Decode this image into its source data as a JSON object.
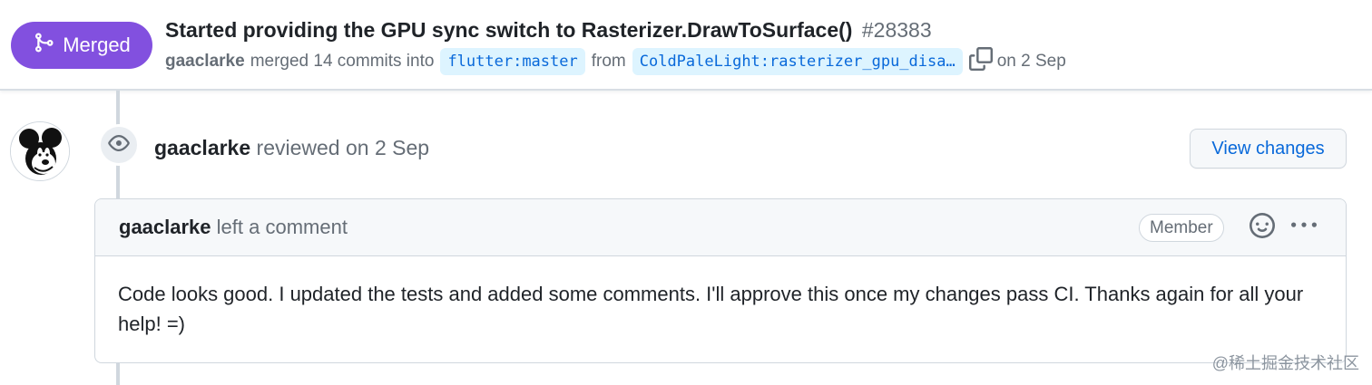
{
  "pr": {
    "state_label": "Merged",
    "state_color": "#8250df",
    "title": "Started providing the GPU sync switch to Rasterizer.DrawToSurface()",
    "number": "#28383",
    "author": "gaaclarke",
    "merged_text": "merged 14 commits into",
    "base_branch": "flutter:master",
    "from_text": "from",
    "head_branch": "ColdPaleLight:rasterizer_gpu_disable_sync_switch",
    "head_branch_display": "ColdPaleLight:rasterizer_gpu_disa…",
    "date_text": "on 2 Sep"
  },
  "review": {
    "author": "gaaclarke",
    "action_text": "reviewed on 2 Sep",
    "view_changes_label": "View changes"
  },
  "comment": {
    "author": "gaaclarke",
    "action_text": "left a comment",
    "role_label": "Member",
    "body": "Code looks good. I updated the tests and added some comments. I'll approve this once my changes pass CI. Thanks again for all your help! =)"
  },
  "icons": {
    "merge": "git-merge-icon",
    "copy": "copy-icon",
    "eye": "eye-icon",
    "emoji": "smiley-icon",
    "more": "kebab-horizontal-icon",
    "avatar": "mickey-mouse-avatar"
  },
  "colors": {
    "accent_link": "#0969da",
    "branch_bg": "#ddf4ff",
    "muted_text": "#656d76"
  },
  "watermark": "@稀土掘金技术社区"
}
